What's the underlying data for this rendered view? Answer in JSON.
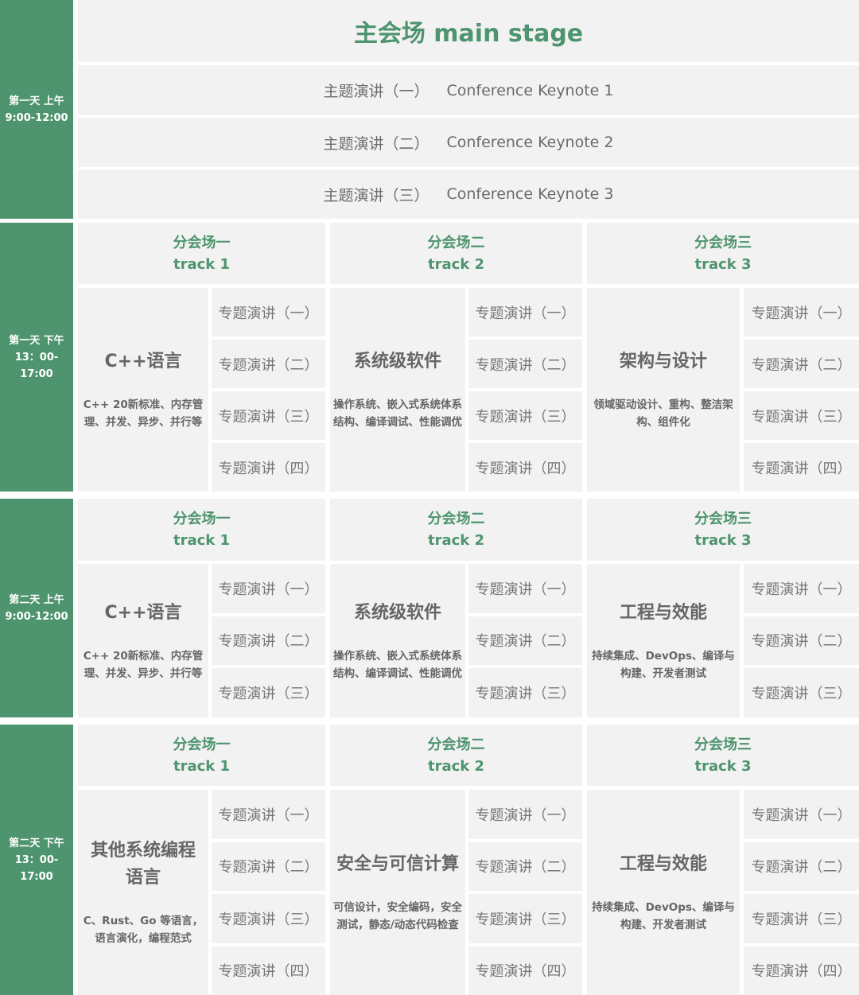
{
  "colors": {
    "accent": "#4e946e",
    "cell_bg": "#f2f2f2",
    "text": "#666666"
  },
  "main_stage": {
    "title": "主会场 main stage",
    "day_label": "第一天 上午\n9:00-12:00",
    "keynotes": [
      {
        "zh": "主题演讲（一）",
        "en": "Conference Keynote 1"
      },
      {
        "zh": "主题演讲（二）",
        "en": "Conference Keynote 2"
      },
      {
        "zh": "主题演讲（三）",
        "en": "Conference Keynote 3"
      }
    ]
  },
  "sessions": [
    {
      "day_label": "第一天 下午\n13：00-\n17:00",
      "tracks": [
        {
          "name_zh": "分会场一",
          "name_en": "track 1",
          "topic": "C++语言",
          "desc": "C++ 20新标准、内存管理、并发、异步、并行等",
          "talks": [
            "专题演讲（一）",
            "专题演讲（二）",
            "专题演讲（三）",
            "专题演讲（四）"
          ]
        },
        {
          "name_zh": "分会场二",
          "name_en": "track 2",
          "topic": "系统级软件",
          "desc": "操作系统、嵌入式系统体系结构、编译调试、性能调优",
          "talks": [
            "专题演讲（一）",
            "专题演讲（二）",
            "专题演讲（三）",
            "专题演讲（四）"
          ]
        },
        {
          "name_zh": "分会场三",
          "name_en": "track 3",
          "topic": "架构与设计",
          "desc": "领域驱动设计、重构、整洁架构、组件化",
          "talks": [
            "专题演讲（一）",
            "专题演讲（二）",
            "专题演讲（三）",
            "专题演讲（四）"
          ]
        }
      ]
    },
    {
      "day_label": "第二天 上午\n9:00-12:00",
      "tracks": [
        {
          "name_zh": "分会场一",
          "name_en": "track 1",
          "topic": "C++语言",
          "desc": "C++ 20新标准、内存管理、并发、异步、并行等",
          "talks": [
            "专题演讲（一）",
            "专题演讲（二）",
            "专题演讲（三）"
          ]
        },
        {
          "name_zh": "分会场二",
          "name_en": "track 2",
          "topic": "系统级软件",
          "desc": "操作系统、嵌入式系统体系结构、编译调试、性能调优",
          "talks": [
            "专题演讲（一）",
            "专题演讲（二）",
            "专题演讲（三）"
          ]
        },
        {
          "name_zh": "分会场三",
          "name_en": "track 3",
          "topic": "工程与效能",
          "desc": "持续集成、DevOps、编译与构建、开发者测试",
          "talks": [
            "专题演讲（一）",
            "专题演讲（二）",
            "专题演讲（三）"
          ]
        }
      ]
    },
    {
      "day_label": "第二天 下午\n13：00-\n17:00",
      "tracks": [
        {
          "name_zh": "分会场一",
          "name_en": "track 1",
          "topic": "其他系统编程语言",
          "desc": "C、Rust、Go 等语言，语言演化，编程范式",
          "talks": [
            "专题演讲（一）",
            "专题演讲（二）",
            "专题演讲（三）",
            "专题演讲（四）"
          ]
        },
        {
          "name_zh": "分会场二",
          "name_en": "track 2",
          "topic": "安全与可信计算",
          "desc": "可信设计，安全编码，安全测试，静态/动态代码检查",
          "talks": [
            "专题演讲（一）",
            "专题演讲（二）",
            "专题演讲（三）",
            "专题演讲（四）"
          ]
        },
        {
          "name_zh": "分会场三",
          "name_en": "track 3",
          "topic": "工程与效能",
          "desc": "持续集成、DevOps、编译与构建、开发者测试",
          "talks": [
            "专题演讲（一）",
            "专题演讲（二）",
            "专题演讲（三）",
            "专题演讲（四）"
          ]
        }
      ]
    }
  ]
}
